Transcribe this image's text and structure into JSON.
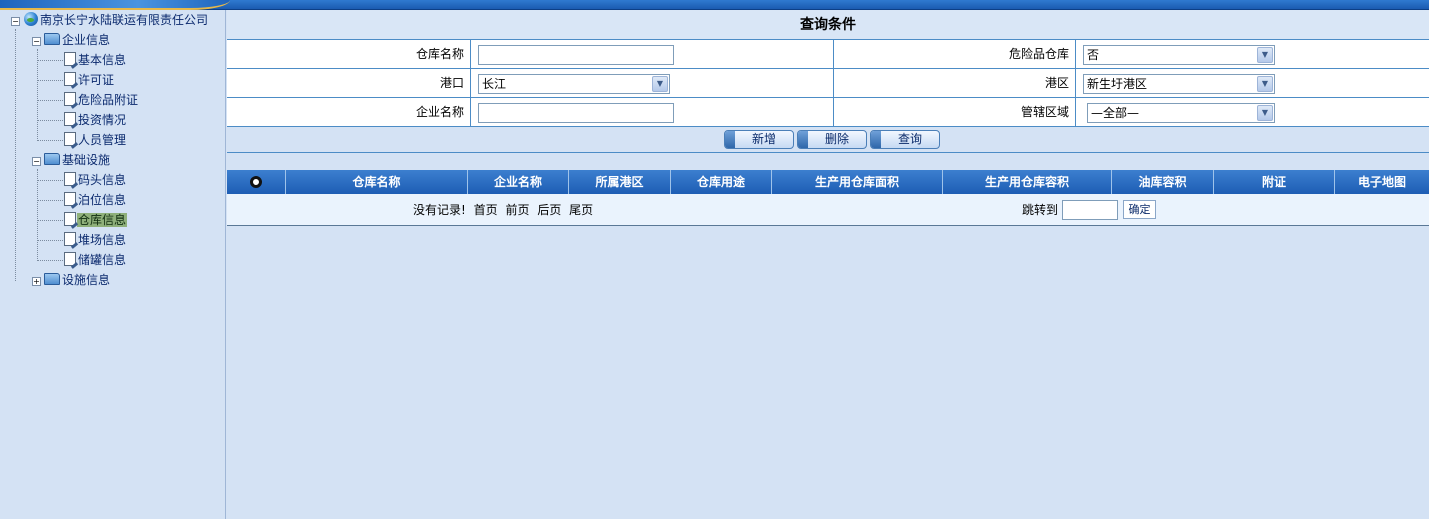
{
  "sidebar": {
    "root": {
      "label": "南京长宁水陆联运有限责任公司"
    },
    "groups": [
      {
        "label": "企业信息",
        "items": [
          "基本信息",
          "许可证",
          "危险品附证",
          "投资情况",
          "人员管理"
        ]
      },
      {
        "label": "基础设施",
        "items": [
          "码头信息",
          "泊位信息",
          "仓库信息",
          "堆场信息",
          "储罐信息"
        ]
      },
      {
        "label": "设施信息",
        "items": []
      }
    ],
    "selected_item": "仓库信息"
  },
  "query": {
    "title": "查询条件",
    "warehouse_name": {
      "label": "仓库名称",
      "value": ""
    },
    "dangerous_warehouse": {
      "label": "危险品仓库",
      "value": "否"
    },
    "port": {
      "label": "港口",
      "value": "长江"
    },
    "port_area": {
      "label": "港区",
      "value": "新生圩港区"
    },
    "company_name": {
      "label": "企业名称",
      "value": ""
    },
    "jurisdiction": {
      "label": "管辖区域",
      "value": "—全部—"
    }
  },
  "buttons": {
    "add": "新增",
    "delete": "删除",
    "search": "查询"
  },
  "table": {
    "columns": [
      "仓库名称",
      "企业名称",
      "所属港区",
      "仓库用途",
      "生产用仓库面积",
      "生产用仓库容积",
      "油库容积",
      "附证",
      "电子地图"
    ]
  },
  "pager": {
    "no_records": "没有记录!",
    "first": "首页",
    "prev": "前页",
    "next": "后页",
    "last": "尾页",
    "jump_label": "跳转到",
    "jump_value": "",
    "ok": "确定"
  },
  "colors": {
    "header_blue": "#1d5db4",
    "panel_bg": "#d4e2f4",
    "border_blue": "#4c8cc6",
    "selected_green": "#8fb07a"
  }
}
